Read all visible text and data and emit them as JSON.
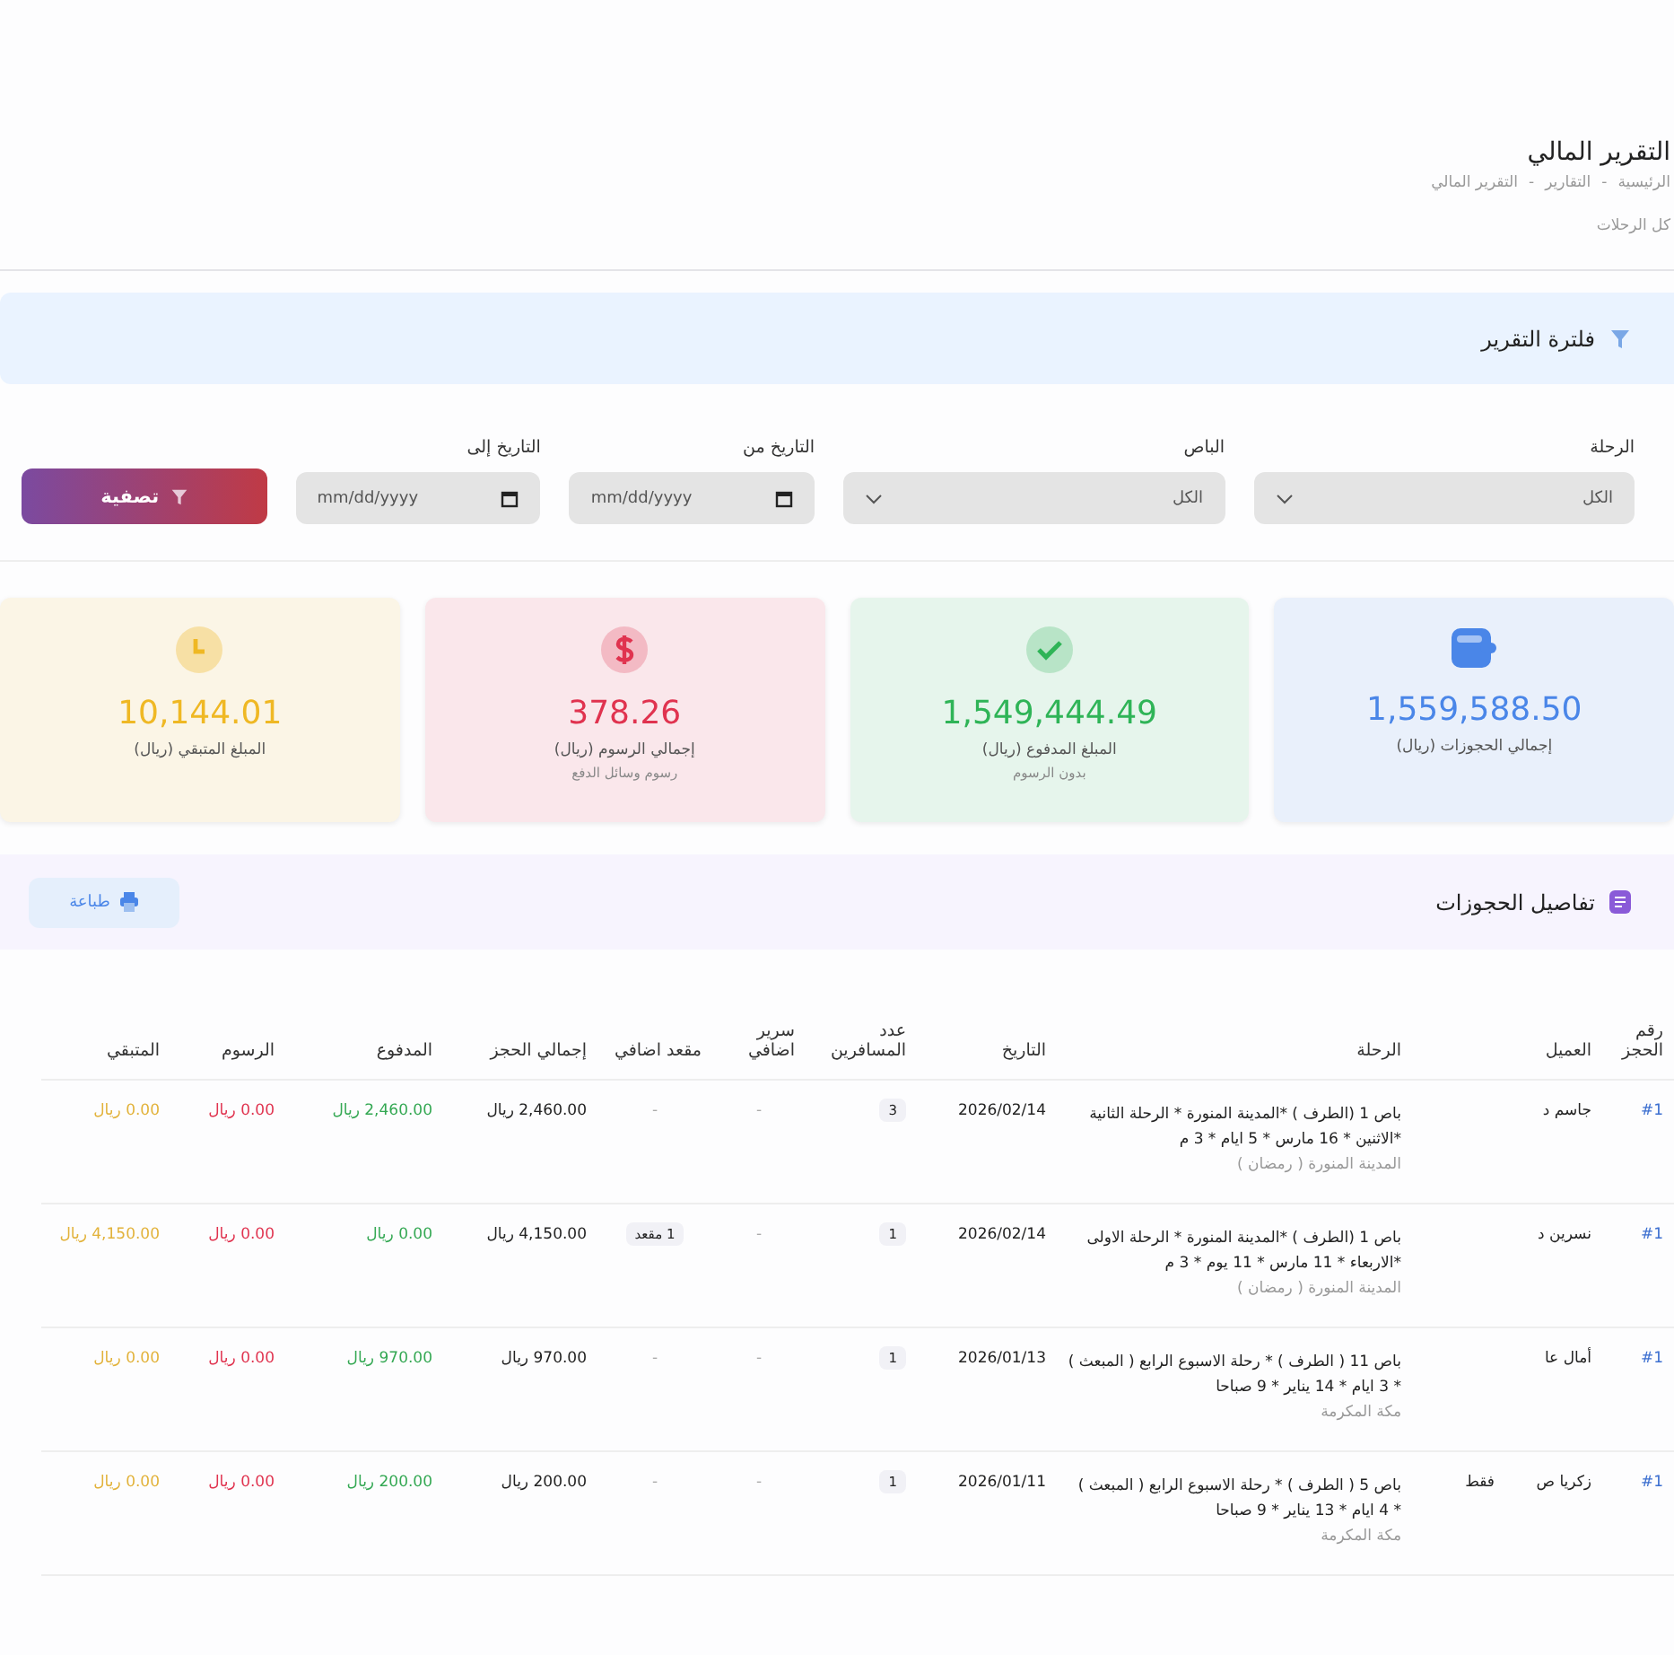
{
  "page": {
    "title": "التقرير المالي",
    "breadcrumb": [
      "الرئيسية",
      "التقارير",
      "التقرير المالي"
    ],
    "breadcrumb_separator": "-",
    "subtitle": "كل الرحلات"
  },
  "filter": {
    "title": "فلترة التقرير",
    "fields": [
      {
        "kind": "select",
        "label": "الرحلة",
        "value": "الكل"
      },
      {
        "kind": "select",
        "label": "الباص",
        "value": "الكل"
      },
      {
        "kind": "date",
        "label": "التاريخ من",
        "placeholder": "mm/dd/yyyy"
      },
      {
        "kind": "date",
        "label": "التاريخ إلى",
        "placeholder": "mm/dd/yyyy"
      }
    ],
    "button": "تصفية"
  },
  "cards": [
    {
      "kind": "wallet",
      "color": "#4a86e8",
      "value": "1,559,588.50",
      "label": "إجمالي الحجوزات (ريال)"
    },
    {
      "kind": "check",
      "color": "#2fb457",
      "value": "1,549,444.49",
      "label": "المبلغ المدفوع (ريال)",
      "note": "بدون الرسوم"
    },
    {
      "kind": "dollar",
      "color": "#e0334f",
      "value": "378.26",
      "label": "إجمالي الرسوم (ريال)",
      "note": "رسوم وسائل الدفع"
    },
    {
      "kind": "clock",
      "color": "#efb824",
      "value": "10,144.01",
      "label": "المبلغ المتبقي (ريال)"
    }
  ],
  "bookings": {
    "title": "تفاصيل الحجوزات",
    "print_button": "طباعة",
    "columns": [
      "رقم الحجز",
      "العميل",
      "",
      "الرحلة",
      "التاريخ",
      "عدد المسافرين",
      "سرير اضافي",
      "مقعد اضافي",
      "إجمالي الحجز",
      "المدفوع",
      "الرسوم",
      "المتبقي"
    ],
    "rows": [
      {
        "number": "#1",
        "customer": "جاسم د",
        "trip": "باص 1 (الطرف ) *المدينة المنورة * الرحلة الثانية *الاثنين * 16 مارس * 5 ايام * 3 م",
        "destination": "المدينة المنورة ( رمضان )",
        "date": "2026/02/14",
        "passengers": "3",
        "extra_bed": "-",
        "extra_seat": "-",
        "total": "2,460.00 ريال",
        "paid": "2,460.00 ريال",
        "fees": "0.00 ريال",
        "remaining": "0.00 ريال"
      },
      {
        "number": "#1",
        "customer": "نسرين د",
        "trip": "باص 1 (الطرف ) *المدينة المنورة * الرحلة الاولى *الاربعاء * 11 مارس * 11 يوم * 3 م",
        "destination": "المدينة المنورة ( رمضان )",
        "date": "2026/02/14",
        "passengers": "1",
        "extra_bed": "-",
        "extra_seat": "1 مقعد",
        "total": "4,150.00 ريال",
        "paid": "0.00 ريال",
        "fees": "0.00 ريال",
        "remaining": "4,150.00 ريال"
      },
      {
        "number": "#1",
        "customer": "أمال عا",
        "trip": "باص 11 ( الطرف ) * رحلة الاسبوع الرابع ( المبعث ) * 3 ايام * 14 يناير * 9 صباحا",
        "destination": "مكة المكرمة",
        "date": "2026/01/13",
        "passengers": "1",
        "extra_bed": "-",
        "extra_seat": "-",
        "total": "970.00 ريال",
        "paid": "970.00 ريال",
        "fees": "0.00 ريال",
        "remaining": "0.00 ريال"
      },
      {
        "number": "#1",
        "customer": "زكريا ص",
        "column_3": "فقط",
        "trip": "باص 5 ( الطرف ) * رحلة الاسبوع الرابع ( المبعث ) * 4 ايام * 13 يناير * 9 صباحا",
        "destination": "مكة المكرمة",
        "date": "2026/01/11",
        "passengers": "1",
        "extra_bed": "-",
        "extra_seat": "-",
        "total": "200.00 ريال",
        "paid": "200.00 ريال",
        "fees": "0.00 ريال",
        "remaining": "0.00 ريال"
      }
    ]
  }
}
